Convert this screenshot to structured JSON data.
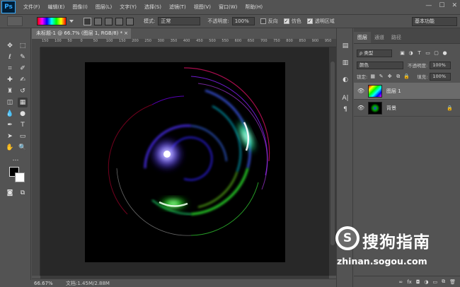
{
  "app": {
    "logo": "Ps",
    "menu": [
      "文件(F)",
      "编辑(E)",
      "图像(I)",
      "图层(L)",
      "文字(Y)",
      "选择(S)",
      "滤镜(T)",
      "视图(V)",
      "窗口(W)",
      "帮助(H)"
    ],
    "window_controls": [
      "—",
      "☐",
      "✕"
    ]
  },
  "options_bar": {
    "mode_label": "模式:",
    "mode_value": "正常",
    "opacity_label": "不透明度:",
    "opacity_value": "100%",
    "reverse_label": "反向",
    "reverse_checked": false,
    "dither_label": "仿色",
    "dither_checked": true,
    "transparency_label": "透明区域",
    "transparency_checked": true,
    "workspace": "基本功能"
  },
  "document": {
    "tab_title": "未标题-1 @ 66.7% (图层 1, RGB/8) *",
    "ruler_ticks": [
      "150",
      "100",
      "50",
      "0",
      "50",
      "100",
      "150",
      "200",
      "250",
      "300",
      "350",
      "400",
      "450",
      "500",
      "550",
      "600",
      "650",
      "700",
      "750",
      "800",
      "850",
      "900",
      "950"
    ],
    "zoom": "66.67%",
    "info": "文档:1.45M/2.88M"
  },
  "layers_panel": {
    "tabs": [
      "图层",
      "通道",
      "路径"
    ],
    "kind_filter": "ρ 类型",
    "blend_mode": "颜色",
    "opacity_label": "不透明度:",
    "opacity_value": "100%",
    "lock_label": "锁定:",
    "fill_label": "填充:",
    "fill_value": "100%",
    "layers": [
      {
        "name": "图层 1",
        "selected": true,
        "visible": true,
        "locked": false
      },
      {
        "name": "背景",
        "selected": false,
        "visible": true,
        "locked": true
      }
    ],
    "bottom_icons": [
      "link-icon",
      "fx-icon",
      "mask-icon",
      "adjustment-icon",
      "group-icon",
      "new-layer-icon",
      "trash-icon"
    ]
  },
  "colors": {
    "foreground": "#000000",
    "background": "#ffffff",
    "ui_bg": "#535353",
    "canvas_bg": "#000000"
  },
  "watermark": {
    "logo_char": "S",
    "cn": "搜狗指南",
    "url": "zhinan.sogou.com"
  }
}
